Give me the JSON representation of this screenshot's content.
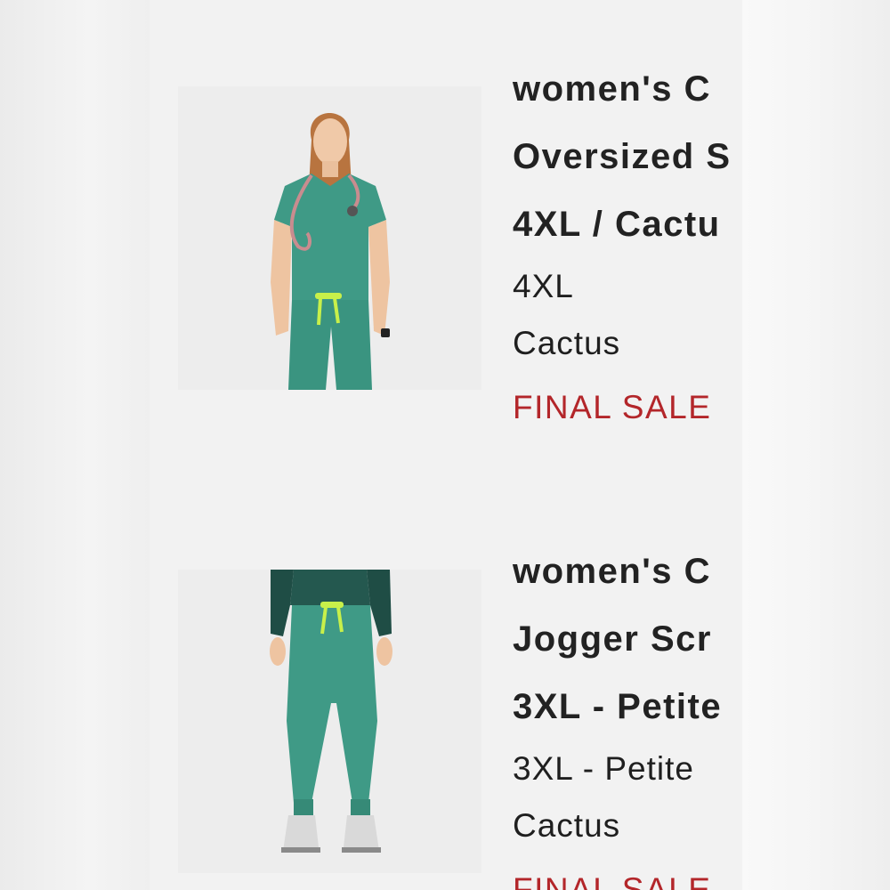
{
  "cart": {
    "items": [
      {
        "title_lines": [
          "women's C",
          "Oversized S",
          "4XL / Cactu"
        ],
        "size": "4XL",
        "color": "Cactus",
        "sale_badge": "FINAL SALE",
        "image_icon": "scrub-top-model-photo"
      },
      {
        "title_lines": [
          "women's C",
          "Jogger Scr",
          "3XL - Petite"
        ],
        "size": "3XL - Petite",
        "color": "Cactus",
        "sale_badge": "FINAL SALE",
        "image_icon": "scrub-jogger-model-photo"
      }
    ]
  },
  "colors": {
    "scrub_green": "#3f9a86",
    "sale_red": "#b3262a",
    "panel_bg": "#f2f2f2"
  }
}
